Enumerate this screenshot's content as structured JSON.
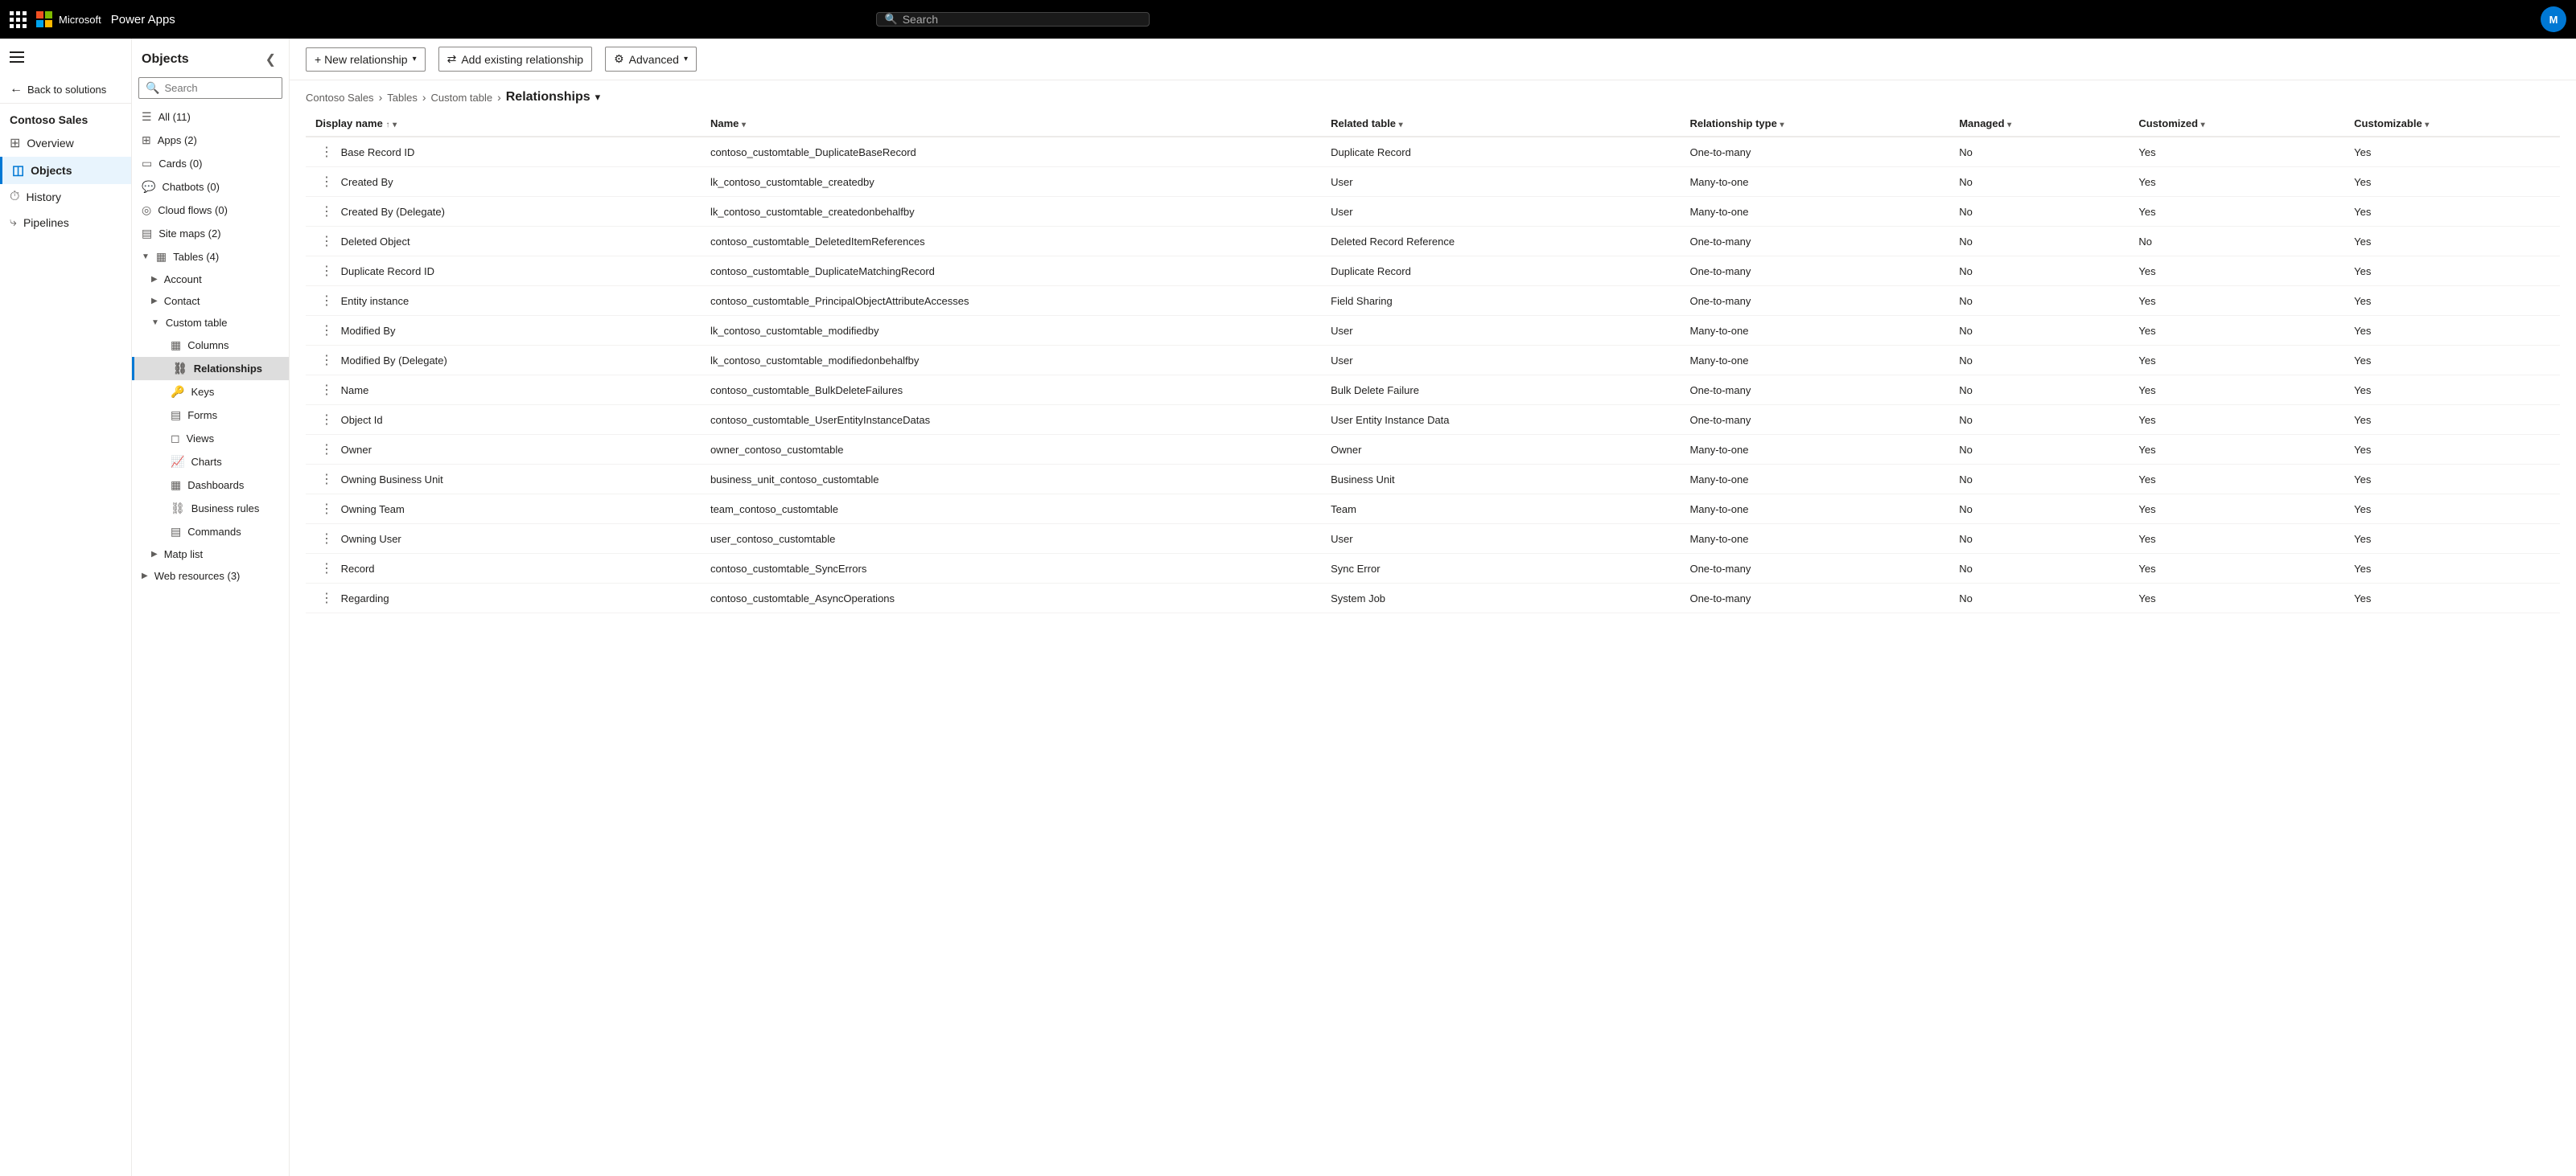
{
  "topbar": {
    "brand": "Power Apps",
    "search_placeholder": "Search",
    "avatar_initials": "M"
  },
  "sidebar": {
    "back_label": "Back to solutions",
    "app_name": "Contoso Sales",
    "items": [
      {
        "id": "overview",
        "label": "Overview",
        "icon": "⊞"
      },
      {
        "id": "objects",
        "label": "Objects",
        "icon": "◫",
        "active": true
      },
      {
        "id": "history",
        "label": "History",
        "icon": "⏱"
      },
      {
        "id": "pipelines",
        "label": "Pipelines",
        "icon": "⤷"
      }
    ]
  },
  "objects_panel": {
    "title": "Objects",
    "search_placeholder": "Search",
    "items": [
      {
        "id": "all",
        "label": "All (11)",
        "icon": "☰",
        "indent": 0
      },
      {
        "id": "apps",
        "label": "Apps (2)",
        "icon": "⊞",
        "indent": 0
      },
      {
        "id": "cards",
        "label": "Cards (0)",
        "icon": "▭",
        "indent": 0
      },
      {
        "id": "chatbots",
        "label": "Chatbots (0)",
        "icon": "💬",
        "indent": 0
      },
      {
        "id": "cloudflows",
        "label": "Cloud flows (0)",
        "icon": "◎",
        "indent": 0
      },
      {
        "id": "sitemaps",
        "label": "Site maps (2)",
        "icon": "▤",
        "indent": 0
      },
      {
        "id": "tables",
        "label": "Tables (4)",
        "icon": "▦",
        "indent": 0,
        "expanded": true
      },
      {
        "id": "account",
        "label": "Account",
        "icon": "",
        "indent": 1,
        "expand_icon": "▶"
      },
      {
        "id": "contact",
        "label": "Contact",
        "icon": "",
        "indent": 1,
        "expand_icon": "▶"
      },
      {
        "id": "customtable",
        "label": "Custom table",
        "icon": "",
        "indent": 1,
        "expanded": true,
        "expand_icon": "▼"
      },
      {
        "id": "columns",
        "label": "Columns",
        "icon": "▦",
        "indent": 3
      },
      {
        "id": "relationships",
        "label": "Relationships",
        "icon": "⛓",
        "indent": 3,
        "active": true
      },
      {
        "id": "keys",
        "label": "Keys",
        "icon": "🔑",
        "indent": 3
      },
      {
        "id": "forms",
        "label": "Forms",
        "icon": "▤",
        "indent": 3
      },
      {
        "id": "views",
        "label": "Views",
        "icon": "◻",
        "indent": 3
      },
      {
        "id": "charts",
        "label": "Charts",
        "icon": "📈",
        "indent": 3
      },
      {
        "id": "dashboards",
        "label": "Dashboards",
        "icon": "▦",
        "indent": 3
      },
      {
        "id": "businessrules",
        "label": "Business rules",
        "icon": "⛓",
        "indent": 3
      },
      {
        "id": "commands",
        "label": "Commands",
        "icon": "▤",
        "indent": 3
      },
      {
        "id": "maplist",
        "label": "Matp list",
        "icon": "",
        "indent": 1,
        "expand_icon": "▶"
      },
      {
        "id": "webresources",
        "label": "Web resources (3)",
        "icon": "",
        "indent": 0,
        "expand_icon": "▶"
      }
    ]
  },
  "toolbar": {
    "new_relationship_label": "+ New relationship",
    "add_existing_label": "Add existing relationship",
    "advanced_label": "Advanced"
  },
  "breadcrumb": {
    "parts": [
      "Contoso Sales",
      "Tables",
      "Custom table"
    ],
    "current": "Relationships"
  },
  "table": {
    "columns": [
      {
        "id": "display_name",
        "label": "Display name",
        "sort": "↑",
        "filter": true
      },
      {
        "id": "name",
        "label": "Name",
        "filter": true
      },
      {
        "id": "related_table",
        "label": "Related table",
        "filter": true
      },
      {
        "id": "relationship_type",
        "label": "Relationship type",
        "filter": true
      },
      {
        "id": "managed",
        "label": "Managed",
        "filter": true
      },
      {
        "id": "customized",
        "label": "Customized",
        "filter": true
      },
      {
        "id": "customizable",
        "label": "Customizable",
        "filter": true
      }
    ],
    "rows": [
      {
        "display_name": "Base Record ID",
        "name": "contoso_customtable_DuplicateBaseRecord",
        "related_table": "Duplicate Record",
        "relationship_type": "One-to-many",
        "managed": "No",
        "customized": "Yes",
        "customizable": "Yes"
      },
      {
        "display_name": "Created By",
        "name": "lk_contoso_customtable_createdby",
        "related_table": "User",
        "relationship_type": "Many-to-one",
        "managed": "No",
        "customized": "Yes",
        "customizable": "Yes"
      },
      {
        "display_name": "Created By (Delegate)",
        "name": "lk_contoso_customtable_createdonbehalfby",
        "related_table": "User",
        "relationship_type": "Many-to-one",
        "managed": "No",
        "customized": "Yes",
        "customizable": "Yes"
      },
      {
        "display_name": "Deleted Object",
        "name": "contoso_customtable_DeletedItemReferences",
        "related_table": "Deleted Record Reference",
        "relationship_type": "One-to-many",
        "managed": "No",
        "customized": "No",
        "customizable": "Yes"
      },
      {
        "display_name": "Duplicate Record ID",
        "name": "contoso_customtable_DuplicateMatchingRecord",
        "related_table": "Duplicate Record",
        "relationship_type": "One-to-many",
        "managed": "No",
        "customized": "Yes",
        "customizable": "Yes"
      },
      {
        "display_name": "Entity instance",
        "name": "contoso_customtable_PrincipalObjectAttributeAccesses",
        "related_table": "Field Sharing",
        "relationship_type": "One-to-many",
        "managed": "No",
        "customized": "Yes",
        "customizable": "Yes"
      },
      {
        "display_name": "Modified By",
        "name": "lk_contoso_customtable_modifiedby",
        "related_table": "User",
        "relationship_type": "Many-to-one",
        "managed": "No",
        "customized": "Yes",
        "customizable": "Yes"
      },
      {
        "display_name": "Modified By (Delegate)",
        "name": "lk_contoso_customtable_modifiedonbehalfby",
        "related_table": "User",
        "relationship_type": "Many-to-one",
        "managed": "No",
        "customized": "Yes",
        "customizable": "Yes"
      },
      {
        "display_name": "Name",
        "name": "contoso_customtable_BulkDeleteFailures",
        "related_table": "Bulk Delete Failure",
        "relationship_type": "One-to-many",
        "managed": "No",
        "customized": "Yes",
        "customizable": "Yes"
      },
      {
        "display_name": "Object Id",
        "name": "contoso_customtable_UserEntityInstanceDatas",
        "related_table": "User Entity Instance Data",
        "relationship_type": "One-to-many",
        "managed": "No",
        "customized": "Yes",
        "customizable": "Yes"
      },
      {
        "display_name": "Owner",
        "name": "owner_contoso_customtable",
        "related_table": "Owner",
        "relationship_type": "Many-to-one",
        "managed": "No",
        "customized": "Yes",
        "customizable": "Yes"
      },
      {
        "display_name": "Owning Business Unit",
        "name": "business_unit_contoso_customtable",
        "related_table": "Business Unit",
        "relationship_type": "Many-to-one",
        "managed": "No",
        "customized": "Yes",
        "customizable": "Yes"
      },
      {
        "display_name": "Owning Team",
        "name": "team_contoso_customtable",
        "related_table": "Team",
        "relationship_type": "Many-to-one",
        "managed": "No",
        "customized": "Yes",
        "customizable": "Yes"
      },
      {
        "display_name": "Owning User",
        "name": "user_contoso_customtable",
        "related_table": "User",
        "relationship_type": "Many-to-one",
        "managed": "No",
        "customized": "Yes",
        "customizable": "Yes"
      },
      {
        "display_name": "Record",
        "name": "contoso_customtable_SyncErrors",
        "related_table": "Sync Error",
        "relationship_type": "One-to-many",
        "managed": "No",
        "customized": "Yes",
        "customizable": "Yes"
      },
      {
        "display_name": "Regarding",
        "name": "contoso_customtable_AsyncOperations",
        "related_table": "System Job",
        "relationship_type": "One-to-many",
        "managed": "No",
        "customized": "Yes",
        "customizable": "Yes"
      }
    ]
  }
}
